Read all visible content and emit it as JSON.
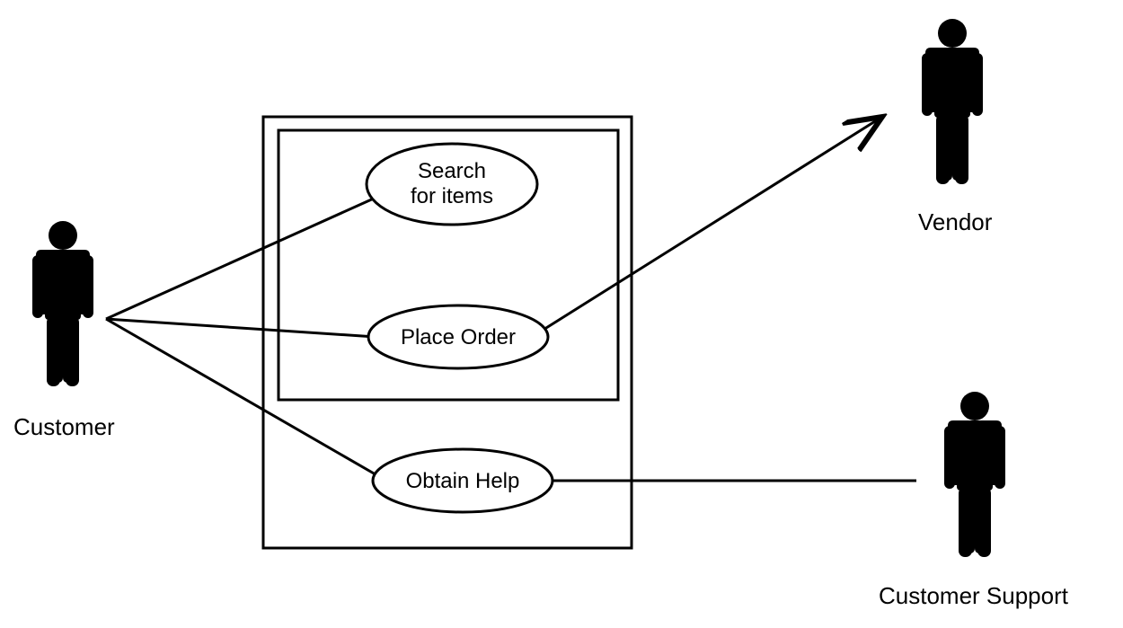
{
  "diagram": {
    "type": "uml-use-case",
    "actors": {
      "customer": {
        "label": "Customer"
      },
      "vendor": {
        "label": "Vendor"
      },
      "support": {
        "label": "Customer Support"
      }
    },
    "usecases": {
      "search": {
        "line1": "Search",
        "line2": "for items"
      },
      "place_order": {
        "label": "Place Order"
      },
      "obtain_help": {
        "label": "Obtain Help"
      }
    },
    "associations": [
      {
        "from": "customer",
        "to": "search",
        "arrow": false
      },
      {
        "from": "customer",
        "to": "place_order",
        "arrow": false
      },
      {
        "from": "customer",
        "to": "obtain_help",
        "arrow": false
      },
      {
        "from": "place_order",
        "to": "vendor",
        "arrow": true
      },
      {
        "from": "obtain_help",
        "to": "support",
        "arrow": false
      }
    ]
  }
}
